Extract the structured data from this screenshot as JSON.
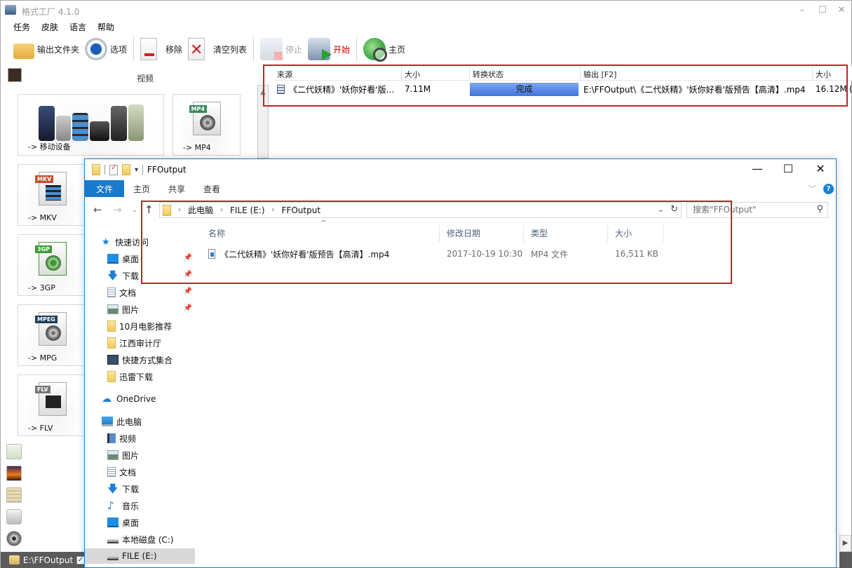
{
  "app": {
    "title": "格式工厂 4.1.0",
    "window_controls": {
      "minimize": "–",
      "maximize": "☐",
      "close": "✕"
    },
    "menu": [
      "任务",
      "皮肤",
      "语言",
      "帮助"
    ],
    "toolbar": [
      {
        "label": "输出文件夹",
        "icon": "output-folder-icon",
        "state": "normal"
      },
      {
        "label": "选项",
        "icon": "options-gear-icon",
        "state": "normal"
      },
      {
        "label": "移除",
        "icon": "remove-doc-icon",
        "state": "normal"
      },
      {
        "label": "清空列表",
        "icon": "clear-list-icon",
        "state": "normal"
      },
      {
        "label": "停止",
        "icon": "stop-icon",
        "state": "disabled"
      },
      {
        "label": "开始",
        "icon": "start-icon",
        "state": "highlight"
      },
      {
        "label": "主页",
        "icon": "homepage-globe-icon",
        "state": "normal"
      }
    ],
    "category": {
      "label": "视频",
      "icon": "clapperboard-icon"
    },
    "tiles": [
      {
        "label": "-> 移动设备",
        "icon": "mobile-devices-icon"
      },
      {
        "label": "-> MP4",
        "icon": "mp4-file-icon",
        "tag": "MP4",
        "tag_color": "#3a8a5e"
      },
      {
        "label": "-> MKV",
        "icon": "mkv-file-icon",
        "tag": "MKV",
        "tag_color": "#c0532e"
      },
      {
        "label": "-> 3GP",
        "icon": "3gp-file-icon",
        "tag": "3GP",
        "tag_color": "#3d9a34"
      },
      {
        "label": "-> MPG",
        "icon": "mpeg-file-icon",
        "tag": "MPEG",
        "tag_color": "#1f3f58"
      },
      {
        "label": "-> FLV",
        "icon": "flv-file-icon",
        "tag": "FLV",
        "tag_color": "#777777"
      }
    ],
    "side_categories": [
      "audio-icon",
      "picture-icon",
      "document-icon",
      "rom-device-icon",
      "utilities-icon"
    ],
    "status": {
      "output_path": "E:\\FFOutput",
      "checkbox": "✓"
    },
    "task_list": {
      "columns": [
        "来源",
        "大小",
        "转换状态",
        "输出 [F2]",
        "大小"
      ],
      "rows": [
        {
          "source": "《二代妖精》'妖你好看'版...",
          "size": "7.11M",
          "status": "完成",
          "progress_percent": 100,
          "output": "E:\\FFOutput\\《二代妖精》'妖你好看'版预告【高清】.mp4",
          "output_size": "16.12M",
          "extra": "("
        }
      ]
    },
    "status_color": "#4f7fe4",
    "highlight_color": "#cc1f27"
  },
  "explorer": {
    "title": "FFOutput",
    "window_controls": {
      "minimize": "—",
      "maximize": "☐",
      "close": "✕"
    },
    "ribbon_tabs": [
      "文件",
      "主页",
      "共享",
      "查看"
    ],
    "nav": {
      "back": "←",
      "forward": "→",
      "recent": "⌄",
      "up": "↑",
      "refresh": "↻",
      "dropdown": "⌄"
    },
    "breadcrumb": [
      "此电脑",
      "FILE (E:)",
      "FFOutput"
    ],
    "search": {
      "placeholder": "搜索\"FFOutput\"",
      "value": ""
    },
    "help": "?",
    "nav_pane": [
      {
        "label": "快速访问",
        "icon": "quick-access-star-icon",
        "level": 0,
        "pinned": false
      },
      {
        "label": "桌面",
        "icon": "desktop-icon",
        "level": 1,
        "pinned": true
      },
      {
        "label": "下载",
        "icon": "downloads-icon",
        "level": 1,
        "pinned": true
      },
      {
        "label": "文档",
        "icon": "documents-icon",
        "level": 1,
        "pinned": true
      },
      {
        "label": "图片",
        "icon": "pictures-icon",
        "level": 1,
        "pinned": true
      },
      {
        "label": "10月电影推荐",
        "icon": "folder-icon",
        "level": 1,
        "pinned": false
      },
      {
        "label": "江西审计厅",
        "icon": "folder-icon",
        "level": 1,
        "pinned": false
      },
      {
        "label": "快捷方式集合",
        "icon": "shortcut-folder-icon",
        "level": 1,
        "pinned": false
      },
      {
        "label": "迅雷下载",
        "icon": "folder-icon",
        "level": 1,
        "pinned": false
      },
      {
        "label": "OneDrive",
        "icon": "onedrive-cloud-icon",
        "level": 0,
        "pinned": false
      },
      {
        "label": "此电脑",
        "icon": "this-pc-icon",
        "level": 0,
        "pinned": false
      },
      {
        "label": "视频",
        "icon": "videos-icon",
        "level": 1,
        "pinned": false
      },
      {
        "label": "图片",
        "icon": "pictures-icon",
        "level": 1,
        "pinned": false
      },
      {
        "label": "文档",
        "icon": "documents-icon",
        "level": 1,
        "pinned": false
      },
      {
        "label": "下载",
        "icon": "downloads-icon",
        "level": 1,
        "pinned": false
      },
      {
        "label": "音乐",
        "icon": "music-icon",
        "level": 1,
        "pinned": false
      },
      {
        "label": "桌面",
        "icon": "desktop-icon",
        "level": 1,
        "pinned": false
      },
      {
        "label": "本地磁盘 (C:)",
        "icon": "local-disk-icon",
        "level": 1,
        "pinned": false
      },
      {
        "label": "FILE (E:)",
        "icon": "drive-icon",
        "level": 1,
        "pinned": false,
        "selected": true
      }
    ],
    "file_columns": [
      "名称",
      "修改日期",
      "类型",
      "大小"
    ],
    "sort_indicator": "^",
    "files": [
      {
        "name": "《二代妖精》'妖你好看'版预告【高清】.mp4",
        "modified": "2017-10-19 10:30",
        "type": "MP4 文件",
        "size": "16,511 KB"
      }
    ]
  }
}
